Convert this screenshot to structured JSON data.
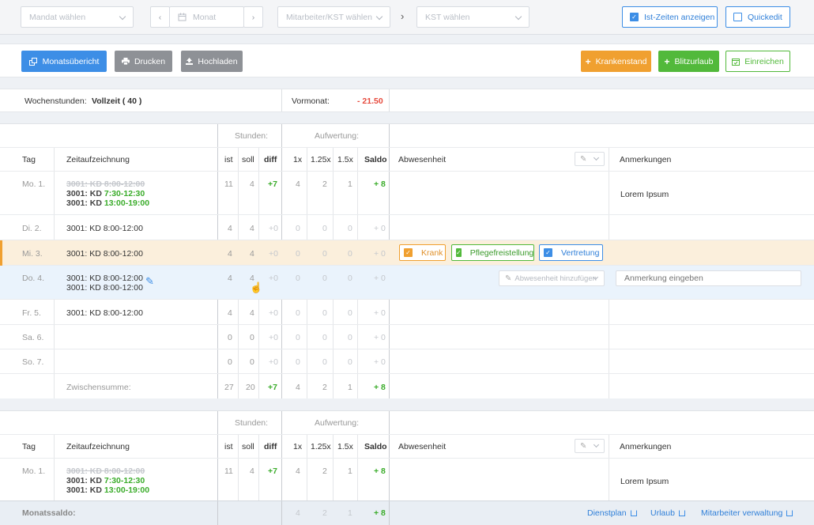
{
  "topbar": {
    "mandant_placeholder": "Mandat wählen",
    "month_placeholder": "Monat",
    "employee_placeholder": "Mitarbeiter/KST wählen",
    "kst_placeholder": "KST wählen",
    "ist_zeiten_label": "Ist-Zeiten anzeigen",
    "quickedit_label": "Quickedit"
  },
  "toolbar": {
    "overview_label": "Monatsübericht",
    "print_label": "Drucken",
    "upload_label": "Hochladen",
    "sick_label": "Krankenstand",
    "flash_label": "Blitzurlaub",
    "submit_label": "Einreichen"
  },
  "colors": {
    "primary": "#3d8ee6",
    "gray": "#8e9196",
    "orange": "#f0a030",
    "green": "#52b93b",
    "red": "#e64a3d"
  },
  "info": {
    "wochenstunden_label": "Wochenstunden:",
    "wochenstunden_value": "Vollzeit ( 40 )",
    "vormonat_label": "Vormonat:",
    "vormonat_value": "- 21.50"
  },
  "table": {
    "group_stunden": "Stunden:",
    "group_aufwertung": "Aufwertung:",
    "col_tag": "Tag",
    "col_zeit": "Zeitaufzeichnung",
    "col_ist": "ist",
    "col_soll": "soll",
    "col_diff": "diff",
    "col_1x": "1x",
    "col_125": "1.25x",
    "col_15": "1.5x",
    "col_saldo": "Saldo",
    "col_abw": "Abwesenheit",
    "col_anm": "Anmerkungen"
  },
  "week": {
    "mo": {
      "tag": "Mo. 1.",
      "e1": "3001: KD 8:00-12:00",
      "e2a": "3001: KD ",
      "e2b": "7:30-12:30",
      "e3a": "3001: KD ",
      "e3b": "13:00-19:00",
      "ist": "11",
      "soll": "4",
      "diff": "+7",
      "a1": "4",
      "a2": "2",
      "a3": "1",
      "saldo": "+ 8",
      "note": "Lorem Ipsum"
    },
    "di": {
      "tag": "Di. 2.",
      "e1": "3001: KD 8:00-12:00",
      "ist": "4",
      "soll": "4",
      "diff": "+0",
      "a1": "0",
      "a2": "0",
      "a3": "0",
      "saldo": "+ 0"
    },
    "mi": {
      "tag": "Mi. 3.",
      "e1": "3001: KD 8:00-12:00",
      "ist": "4",
      "soll": "4",
      "diff": "+0",
      "a1": "0",
      "a2": "0",
      "a3": "0",
      "saldo": "+ 0",
      "tag_krank": "Krank",
      "tag_pflege": "Pflegefreistellung",
      "tag_vertretung": "Vertretung"
    },
    "do": {
      "tag": "Do. 4.",
      "e1": "3001: KD 8:00-12:00",
      "e2": "3001: KD 8:00-12:00",
      "ist": "4",
      "soll": "4",
      "diff": "+0",
      "a1": "0",
      "a2": "0",
      "a3": "0",
      "saldo": "+ 0",
      "abw_placeholder": "Abwesenheit hinzufügen",
      "note_placeholder": "Anmerkung eingeben"
    },
    "fr": {
      "tag": "Fr. 5.",
      "e1": "3001: KD 8:00-12:00",
      "ist": "4",
      "soll": "4",
      "diff": "+0",
      "a1": "0",
      "a2": "0",
      "a3": "0",
      "saldo": "+ 0"
    },
    "sa": {
      "tag": "Sa. 6.",
      "ist": "0",
      "soll": "0",
      "diff": "+0",
      "a1": "0",
      "a2": "0",
      "a3": "0",
      "saldo": "+ 0"
    },
    "so": {
      "tag": "So. 7.",
      "ist": "0",
      "soll": "0",
      "diff": "+0",
      "a1": "0",
      "a2": "0",
      "a3": "0",
      "saldo": "+ 0"
    },
    "sum": {
      "label": "Zwischensumme:",
      "ist": "27",
      "soll": "20",
      "diff": "+7",
      "a1": "4",
      "a2": "2",
      "a3": "1",
      "saldo": "+ 8"
    }
  },
  "week2": {
    "mo": {
      "tag": "Mo. 1.",
      "e1": "3001: KD 8:00-12:00",
      "e2a": "3001: KD ",
      "e2b": "7:30-12:30",
      "e3a": "3001: KD ",
      "e3b": "13:00-19:00",
      "ist": "11",
      "soll": "4",
      "diff": "+7",
      "a1": "4",
      "a2": "2",
      "a3": "1",
      "saldo": "+ 8",
      "note": "Lorem Ipsum"
    }
  },
  "footer": {
    "label": "Monatssaldo:",
    "a1": "4",
    "a2": "2",
    "a3": "1",
    "saldo": "+ 8",
    "link1": "Dienstplan",
    "link2": "Urlaub",
    "link3": "Mitarbeiter verwaltung"
  }
}
